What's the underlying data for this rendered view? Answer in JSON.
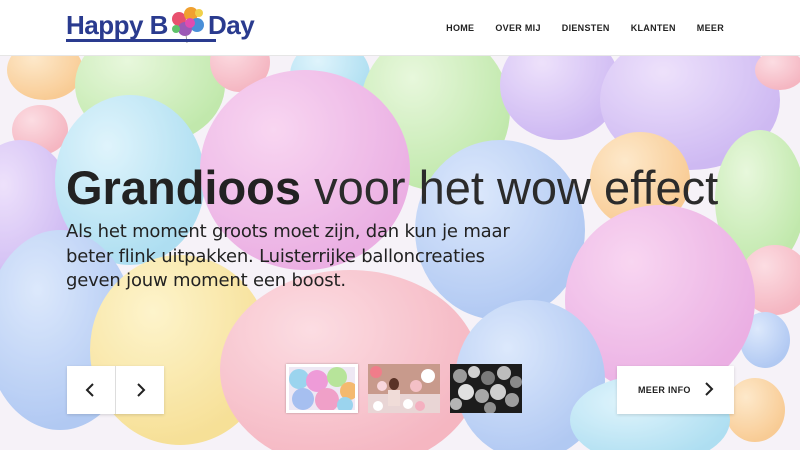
{
  "header": {
    "logo": {
      "text_left": "Happy B",
      "text_right": "Day"
    },
    "nav": [
      "HOME",
      "OVER MIJ",
      "DIENSTEN",
      "KLANTEN",
      "MEER"
    ]
  },
  "hero": {
    "title_strong": "Grandioos",
    "title_light": "voor het wow effect",
    "text": "Als het moment groots moet zijn, dan kun je maar beter flink uitpakken. Luisterrijke balloncreaties geven jouw moment een boost.",
    "prev_icon": "chevron-left-icon",
    "next_icon": "chevron-right-icon",
    "more_label": "MEER INFO",
    "more_icon": "chevron-right-icon",
    "thumbnails": [
      "pastel-balloons",
      "girl-with-balloons",
      "silver-balloons"
    ],
    "active_thumbnail": 1
  },
  "colors": {
    "logo_blue": "#2a3b8f",
    "text_dark": "#222222",
    "white": "#ffffff"
  }
}
